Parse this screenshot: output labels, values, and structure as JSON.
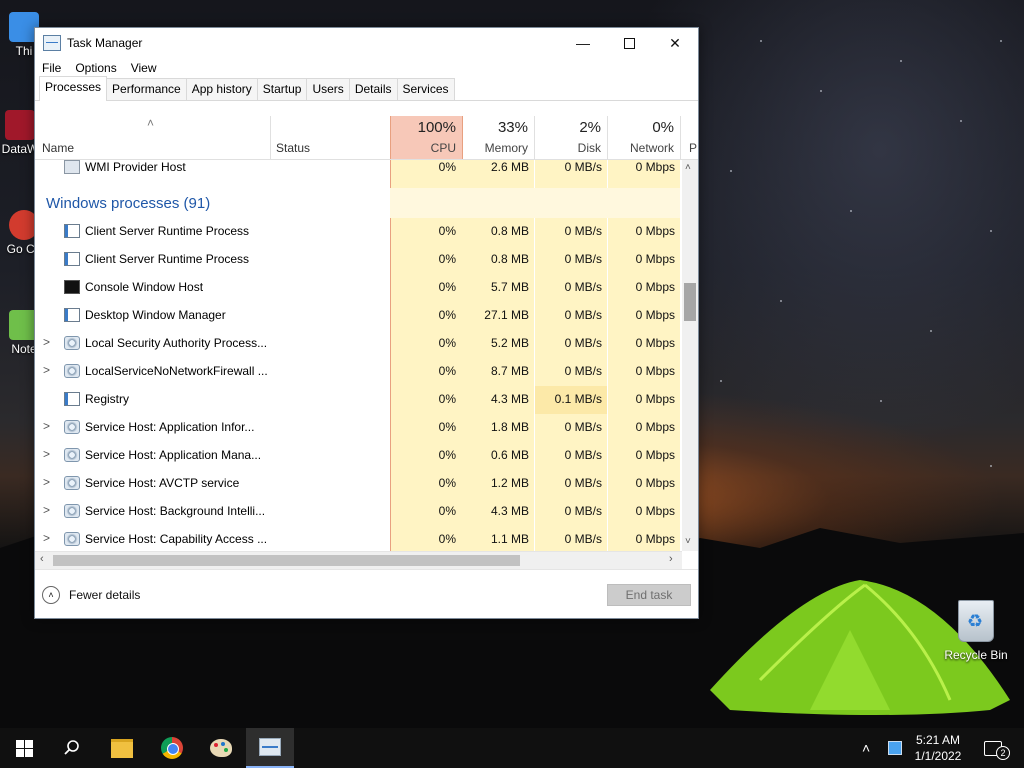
{
  "window": {
    "title": "Task Manager",
    "menu": [
      "File",
      "Options",
      "View"
    ],
    "tabs": [
      "Processes",
      "Performance",
      "App history",
      "Startup",
      "Users",
      "Details",
      "Services"
    ],
    "active_tab": "Processes"
  },
  "columns": {
    "name": "Name",
    "status": "Status",
    "cpu": {
      "pct": "100%",
      "label": "CPU"
    },
    "memory": {
      "pct": "33%",
      "label": "Memory"
    },
    "disk": {
      "pct": "2%",
      "label": "Disk"
    },
    "network": {
      "pct": "0%",
      "label": "Network"
    },
    "power": "P"
  },
  "top_row": {
    "name": "WMI Provider Host",
    "cpu": "0%",
    "memory": "2.6 MB",
    "disk": "0 MB/s",
    "network": "0 Mbps"
  },
  "group_label": "Windows processes (91)",
  "processes": [
    {
      "name": "Client Server Runtime Process",
      "expand": "",
      "cpu": "0%",
      "memory": "0.8 MB",
      "disk": "0 MB/s",
      "network": "0 Mbps"
    },
    {
      "name": "Client Server Runtime Process",
      "expand": "",
      "cpu": "0%",
      "memory": "0.8 MB",
      "disk": "0 MB/s",
      "network": "0 Mbps"
    },
    {
      "name": "Console Window Host",
      "expand": "",
      "cpu": "0%",
      "memory": "5.7 MB",
      "disk": "0 MB/s",
      "network": "0 Mbps"
    },
    {
      "name": "Desktop Window Manager",
      "expand": "",
      "cpu": "0%",
      "memory": "27.1 MB",
      "disk": "0 MB/s",
      "network": "0 Mbps"
    },
    {
      "name": "Local Security Authority Process...",
      "expand": ">",
      "cpu": "0%",
      "memory": "5.2 MB",
      "disk": "0 MB/s",
      "network": "0 Mbps"
    },
    {
      "name": "LocalServiceNoNetworkFirewall ...",
      "expand": ">",
      "cpu": "0%",
      "memory": "8.7 MB",
      "disk": "0 MB/s",
      "network": "0 Mbps"
    },
    {
      "name": "Registry",
      "expand": "",
      "cpu": "0%",
      "memory": "4.3 MB",
      "disk": "0.1 MB/s",
      "network": "0 Mbps"
    },
    {
      "name": "Service Host: Application Infor...",
      "expand": ">",
      "cpu": "0%",
      "memory": "1.8 MB",
      "disk": "0 MB/s",
      "network": "0 Mbps"
    },
    {
      "name": "Service Host: Application Mana...",
      "expand": ">",
      "cpu": "0%",
      "memory": "0.6 MB",
      "disk": "0 MB/s",
      "network": "0 Mbps"
    },
    {
      "name": "Service Host: AVCTP service",
      "expand": ">",
      "cpu": "0%",
      "memory": "1.2 MB",
      "disk": "0 MB/s",
      "network": "0 Mbps"
    },
    {
      "name": "Service Host: Background Intelli...",
      "expand": ">",
      "cpu": "0%",
      "memory": "4.3 MB",
      "disk": "0 MB/s",
      "network": "0 Mbps"
    },
    {
      "name": "Service Host: Capability Access ...",
      "expand": ">",
      "cpu": "0%",
      "memory": "1.1 MB",
      "disk": "0 MB/s",
      "network": "0 Mbps"
    }
  ],
  "footer": {
    "fewer_details": "Fewer details",
    "end_task": "End task"
  },
  "desktop": {
    "icons": [
      "Thi",
      "DataW",
      "Go Ch",
      "Note"
    ],
    "recycle_bin": "Recycle Bin"
  },
  "taskbar": {
    "time": "5:21 AM",
    "date": "1/1/2022",
    "notifications": "2"
  }
}
